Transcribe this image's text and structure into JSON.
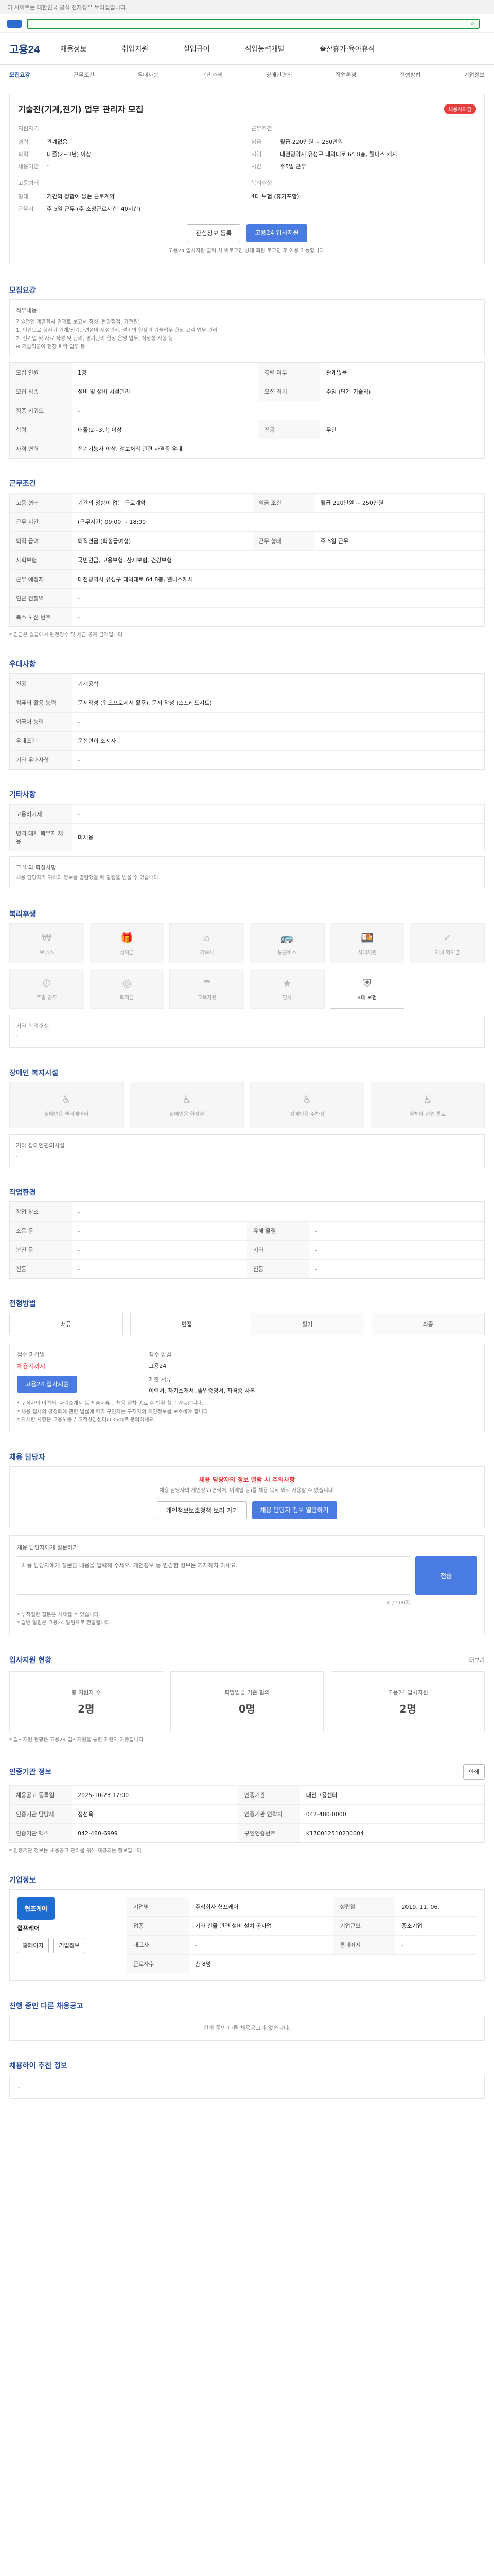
{
  "topbar": {
    "text": "이 사이트는 대한민국 공식 전자정부 누리집입니다."
  },
  "header": {
    "brand": "고용24",
    "menu": [
      "채용정보",
      "취업지원",
      "실업급여",
      "직업능력개발",
      "출산휴가·육아휴직"
    ],
    "subtabs": [
      "모집요강",
      "근무조건",
      "우대사항",
      "복리후생",
      "장애인편의",
      "작업환경",
      "전형방법",
      "기업정보"
    ]
  },
  "job": {
    "title": "기술전(기계,전기) 업무 관리자 모집",
    "badge": "채용시마감",
    "recruit_summary": {
      "section_label": "지원자격",
      "career_k": "경력",
      "career_v": "관계없음",
      "edu_k": "학력",
      "edu_v": "대졸(2~3년) 이상",
      "deadline_k": "채용기간",
      "deadline_v": "-"
    },
    "condition_summary": {
      "section_label": "근무조건",
      "pay_k": "임금",
      "pay_v": "월급 220만원 ~ 250만원",
      "loc_k": "지역",
      "loc_v": "대전광역시 유성구 대덕대로 64 8층, 웰니스 캐시",
      "time_k": "시간",
      "time_v": "주5일 근무"
    },
    "work_summary": {
      "section_label": "고용형태",
      "type_k": "형태",
      "type_v": "기간의 정함이 없는 근로계약",
      "place_k": "근무지",
      "place_v": "주 5일 근무 (주 소정근로시간: 40시간)"
    },
    "benefit_summary": {
      "section_label": "복리후생",
      "v": "4대 보험 (휴가포함)"
    },
    "actions": {
      "scrap": "관심정보 등록",
      "apply": "고용24 입사지원"
    },
    "action_note": "고용24 입사지원 클릭 시 비로그인 상태 회원 로그인 후 이용 가능합니다."
  },
  "sections": {
    "recruit": {
      "title": "모집요강",
      "duty_title": "직무내용",
      "duty_lines": [
        "기술전인 계열회사 결과로 보고서 작성, 현장점검, 기전원)",
        "1. 인간으로 공사가 기계/전기관련설비 시설관리, 설비의 현장과 기술업무 현장·고객 업무 관리",
        "2. 전기업 및 자료 작성 및 관리, 평가관리 현장 운영 업무, 적정성 사항 등",
        "※ 기술직군이 현장 파악 업무 등"
      ],
      "rows": [
        {
          "k": "모집 인원",
          "v": "1명",
          "k2": "경력 여부",
          "v2": "관계없음"
        },
        {
          "k": "모집 직종",
          "v": "설비 및 설비 시설관리",
          "k2": "모집 직위",
          "v2": "주임 (단계 기술직)"
        },
        {
          "k": "직종 키워드",
          "v": "-",
          "k2": "",
          "v2": ""
        },
        {
          "k": "학력",
          "v": "대졸(2~3년) 이상",
          "k2": "전공",
          "v2": "무관"
        },
        {
          "k": "자격 면허",
          "v": "전기기능사 이상, 정보처리 관련 자격증 우대",
          "k2": "",
          "v2": ""
        }
      ]
    },
    "condition": {
      "title": "근무조건",
      "rows": [
        {
          "k": "고용 형태",
          "v": "기간의 정함이 없는 근로계약",
          "k2": "임금 조건",
          "v2": "월급 220만원 ~ 250만원"
        },
        {
          "k": "근무 시간",
          "v": "(근무시간) 09:00 ~ 18:00",
          "k2": "",
          "v2": ""
        },
        {
          "k": "퇴직 급여",
          "v": "퇴직연금 (확정급여형)",
          "k2": "근무 형태",
          "v2": "주 5일 근무"
        },
        {
          "k": "사회보험",
          "v": "국민연금, 고용보험, 산재보험, 건강보험",
          "k2": "",
          "v2": ""
        },
        {
          "k": "근무 예정지",
          "v": "대전광역시 유성구 대덕대로 64 8층, 웰니스캐시",
          "k2": "",
          "v2": ""
        },
        {
          "k": "인근 전철역",
          "v": "-",
          "k2": "",
          "v2": ""
        },
        {
          "k": "북스 노선 번호",
          "v": "-",
          "k2": "",
          "v2": ""
        }
      ],
      "footnote": "* 임금은 월급에서 원천징수 및 세금 공제 금액입니다."
    },
    "pref": {
      "title": "우대사항",
      "rows": [
        {
          "k": "전공",
          "v": "기계공학"
        },
        {
          "k": "컴퓨터 활용 능력",
          "v": "문서작성 (워드프로세서 활용), 문서 작성 (스프레드시트)"
        },
        {
          "k": "외국어 능력",
          "v": "-"
        },
        {
          "k": "우대조건",
          "v": "운전면허 소지자"
        },
        {
          "k": "기타 우대사항",
          "v": "-"
        }
      ]
    },
    "other": {
      "title": "기타사항",
      "rows": [
        {
          "k": "고용허가제",
          "v": "-"
        },
        {
          "k": "병역 대체 복무자 채용",
          "v": "미채용"
        }
      ],
      "etc_title": "그 밖의 회정사항",
      "etc_text": "채용 담당자가 귀하의 정보를 열람했을 때 알림을 받을 수 있습니다."
    },
    "benefit": {
      "title": "복리후생",
      "tiles": [
        {
          "icon": "money-icon",
          "label": "보너스"
        },
        {
          "icon": "gift-icon",
          "label": "상여금"
        },
        {
          "icon": "house-icon",
          "label": "기숙사"
        },
        {
          "icon": "car-icon",
          "label": "통근버스"
        },
        {
          "icon": "food-icon",
          "label": "식대지원"
        },
        {
          "icon": "check-icon",
          "label": "자녀 학자금"
        },
        {
          "icon": "clock-icon",
          "label": "주말 근무"
        },
        {
          "icon": "coin-icon",
          "label": "퇴직금"
        },
        {
          "icon": "umbrella-icon",
          "label": "교육지원"
        },
        {
          "icon": "star-icon",
          "label": "연차"
        },
        {
          "icon": "shield-icon",
          "label": "4대 보험",
          "on": true
        }
      ],
      "etc_k": "기타 복리후생",
      "etc_v": "-"
    },
    "disabled": {
      "title": "장애인 복지시설",
      "tiles": [
        {
          "icon": "accessible-icon",
          "label": "장애인용 엘리베이터"
        },
        {
          "icon": "accessible-icon",
          "label": "장애인용 화장실"
        },
        {
          "icon": "accessible-icon",
          "label": "장애인용 주차장"
        },
        {
          "icon": "accessible-icon",
          "label": "휠체어 진입 통로"
        }
      ],
      "etc_k": "기타 장애인편의시설",
      "etc_v": "-"
    },
    "work_env": {
      "title": "작업환경",
      "rows": [
        {
          "k": "작업 장소",
          "v": "-"
        },
        {
          "k": "소음 등",
          "v": "-",
          "k2": "유해 물질",
          "v2": "-"
        },
        {
          "k": "분진 등",
          "v": "-",
          "k2": "기타",
          "v2": "-"
        },
        {
          "k": "진동",
          "v": "-",
          "k2": "진동",
          "v2": "-"
        }
      ]
    },
    "process": {
      "title": "전형방법",
      "steps": [
        "서류",
        "면접",
        "필기",
        "최종"
      ],
      "apply_k": "접수 마감일",
      "apply_v": "채용시까지",
      "method_k": "접수 방법",
      "method_v": "고용24",
      "submit_k": "제출 서류",
      "submit_v": "이력서, 자기소개서, 졸업증명서, 자격증 사본",
      "apply_btn": "고용24 입사지원",
      "notes": [
        "* 구직자의 이력서, 자기소개서 등 제출서류는 채용 절차 종료 후 반환 청구 가능합니다.",
        "* 채용 절차의 공정화에 관한 법률에 따라 구인자는 구직자의 개인정보를 보호해야 합니다.",
        "* 자세한 사항은 고용노동부 고객상담센터(1350)로 문의하세요."
      ]
    },
    "contact": {
      "title": "채용 담당자",
      "alert_title": "채용 담당자의 정보 열람 시 주의사항",
      "alert_text": "채용 담당자의 개인정보(연락처, 이메일 등)를 채용 목적 외로 사용할 수 없습니다.",
      "btn_info": "개인정보보호정책 보러 가기",
      "btn_view": "채용 담당자 정보 열람하기",
      "q_label": "채용 담당자에게 질문하기",
      "q_placeholder": "채용 담당자에게 질문할 내용을 입력해 주세요. 개인정보 등 민감한 정보는 기재하지 마세요.",
      "q_count": "0 / 500자",
      "q_btn": "전송",
      "q_notes": [
        "* 부적절한 질문은 삭제될 수 있습니다.",
        "* 답변 알림은 고용24 알림으로 전달됩니다."
      ]
    },
    "stats": {
      "title": "입사지원 현황",
      "more": "더보기",
      "cards": [
        {
          "label": "총 지원자 수",
          "value": "2명"
        },
        {
          "label": "희망임금 기준 협의",
          "value": "0명"
        },
        {
          "label": "고용24 입사지원",
          "value": "2명"
        }
      ],
      "note": "* 입사지원 현황은 고용24 입사지원을 통한 지원자 기준입니다."
    },
    "org": {
      "title": "인증기관 정보",
      "print": "인쇄",
      "rows": [
        {
          "k": "채용공고 등록일",
          "v": "2025-10-23 17:00",
          "k2": "인증기관",
          "v2": "대전고용센터"
        },
        {
          "k": "인증기관 담당자",
          "v": "정선옥",
          "k2": "인증기관 연락처",
          "v2": "042-480-0000"
        },
        {
          "k": "인증기관 팩스",
          "v": "042-480-6999",
          "k2": "구인인증번호",
          "v2": "K170012510230004"
        }
      ],
      "note": "* 인증기관 정보는 채용공고 관리를 위해 제공되는 정보입니다."
    },
    "company": {
      "title": "기업정보",
      "logo_text": "협프케어",
      "name": "협프케어",
      "btn_home": "홈페이지",
      "btn_more": "기업정보",
      "rows": [
        {
          "k": "기업명",
          "v": "주식회사 협프케어",
          "k2": "설립일",
          "v2": "2019. 11. 06."
        },
        {
          "k": "업종",
          "v": "기타 건물 관련 설비 설치 공사업",
          "k2": "기업규모",
          "v2": "중소기업"
        },
        {
          "k": "대표자",
          "v": "-",
          "k2": "홈페이지",
          "v2": "-"
        },
        {
          "k": "근로자수",
          "v": "총 8명",
          "k2": "",
          "v2": ""
        }
      ]
    },
    "other_jobs": {
      "title": "진행 중인 다른 채용공고",
      "text": "진행 중인 다른 채용공고가 없습니다."
    },
    "recommended": {
      "title": "채용하이 추천 정보",
      "empty": "-"
    }
  },
  "colors": {
    "accent": "#2a4e9b",
    "blue": "#4a7be3",
    "red": "#e83d3d",
    "green": "#1e9a3d"
  }
}
